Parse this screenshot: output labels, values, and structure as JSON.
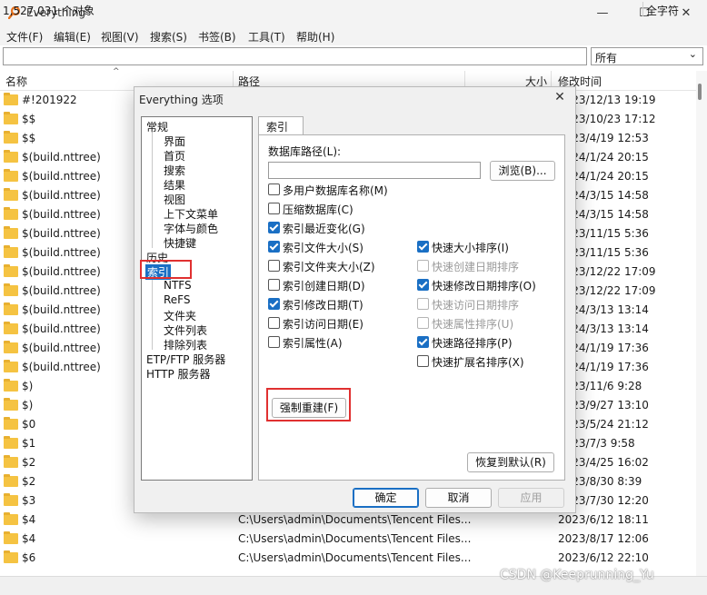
{
  "window": {
    "title": "Everything",
    "minimize": "—",
    "maximize": "☐",
    "close": "✕"
  },
  "menu": [
    "文件(F)",
    "编辑(E)",
    "视图(V)",
    "搜索(S)",
    "书签(B)",
    "工具(T)",
    "帮助(H)"
  ],
  "search": {
    "value": "",
    "filter": "所有"
  },
  "columns": {
    "name": "名称",
    "path": "路径",
    "size": "大小",
    "modified": "修改时间"
  },
  "rows": [
    {
      "name": "#!201922",
      "path": "",
      "date": "2023/12/13 19:19"
    },
    {
      "name": "$$",
      "path": "",
      "date": "2023/10/23 17:12"
    },
    {
      "name": "$$",
      "path": "",
      "date": "2023/4/19 12:53"
    },
    {
      "name": "$(build.nttree)",
      "path": "",
      "date": "2024/1/24 20:15"
    },
    {
      "name": "$(build.nttree)",
      "path": "",
      "date": "2024/1/24 20:15"
    },
    {
      "name": "$(build.nttree)",
      "path": "",
      "date": "2024/3/15 14:58"
    },
    {
      "name": "$(build.nttree)",
      "path": "",
      "date": "2024/3/15 14:58"
    },
    {
      "name": "$(build.nttree)",
      "path": "",
      "date": "2023/11/15 5:36"
    },
    {
      "name": "$(build.nttree)",
      "path": "",
      "date": "2023/11/15 5:36"
    },
    {
      "name": "$(build.nttree)",
      "path": "",
      "date": "2023/12/22 17:09"
    },
    {
      "name": "$(build.nttree)",
      "path": "",
      "date": "2023/12/22 17:09"
    },
    {
      "name": "$(build.nttree)",
      "path": "",
      "date": "2024/3/13 13:14"
    },
    {
      "name": "$(build.nttree)",
      "path": "",
      "date": "2024/3/13 13:14"
    },
    {
      "name": "$(build.nttree)",
      "path": "",
      "date": "2024/1/19 17:36"
    },
    {
      "name": "$(build.nttree)",
      "path": "",
      "date": "2024/1/19 17:36"
    },
    {
      "name": "$)",
      "path": "",
      "date": "2023/11/6 9:28"
    },
    {
      "name": "$)",
      "path": "",
      "date": "2023/9/27 13:10"
    },
    {
      "name": "$0",
      "path": "",
      "date": "2023/5/24 21:12"
    },
    {
      "name": "$1",
      "path": "",
      "date": "2023/7/3 9:58"
    },
    {
      "name": "$2",
      "path": "",
      "date": "2023/4/25 16:02"
    },
    {
      "name": "$2",
      "path": "",
      "date": "2023/8/30 8:39"
    },
    {
      "name": "$3",
      "path": "",
      "date": "2023/7/30 12:20"
    },
    {
      "name": "$4",
      "path": "C:\\Users\\admin\\Documents\\Tencent Files...",
      "date": "2023/6/12 18:11"
    },
    {
      "name": "$4",
      "path": "C:\\Users\\admin\\Documents\\Tencent Files...",
      "date": "2023/8/17 12:06"
    },
    {
      "name": "$6",
      "path": "C:\\Users\\admin\\Documents\\Tencent Files...",
      "date": "2023/6/12 22:10"
    }
  ],
  "status": {
    "count": "1,527,031 个对象",
    "right": "全字符"
  },
  "dialog": {
    "title": "Everything 选项",
    "close": "✕",
    "tree": {
      "general": "常规",
      "general_children": [
        "界面",
        "首页",
        "搜索",
        "结果",
        "视图",
        "上下文菜单",
        "字体与颜色",
        "快捷键"
      ],
      "history": "历史",
      "index": "索引",
      "index_children": [
        "NTFS",
        "ReFS",
        "文件夹",
        "文件列表",
        "排除列表"
      ],
      "ftp": "ETP/FTP 服务器",
      "http": "HTTP 服务器"
    },
    "tab": "索引",
    "db_path_label": "数据库路径(L):",
    "db_path_value": "",
    "browse": "浏览(B)...",
    "options_left": [
      {
        "label": "多用户数据库名称(M)",
        "checked": false
      },
      {
        "label": "压缩数据库(C)",
        "checked": false
      },
      {
        "label": "索引最近变化(G)",
        "checked": true
      },
      {
        "label": "索引文件大小(S)",
        "checked": true
      },
      {
        "label": "索引文件夹大小(Z)",
        "checked": false
      },
      {
        "label": "索引创建日期(D)",
        "checked": false
      },
      {
        "label": "索引修改日期(T)",
        "checked": true
      },
      {
        "label": "索引访问日期(E)",
        "checked": false
      },
      {
        "label": "索引属性(A)",
        "checked": false
      }
    ],
    "options_right": [
      {
        "label": "快速大小排序(I)",
        "checked": true,
        "disabled": false
      },
      {
        "label": "快速创建日期排序",
        "checked": false,
        "disabled": true
      },
      {
        "label": "快速修改日期排序(O)",
        "checked": true,
        "disabled": false
      },
      {
        "label": "快速访问日期排序",
        "checked": false,
        "disabled": true
      },
      {
        "label": "快速属性排序(U)",
        "checked": false,
        "disabled": true
      },
      {
        "label": "快速路径排序(P)",
        "checked": true,
        "disabled": false
      },
      {
        "label": "快速扩展名排序(X)",
        "checked": false,
        "disabled": false
      }
    ],
    "force_rebuild": "强制重建(F)",
    "restore_defaults": "恢复到默认(R)",
    "ok": "确定",
    "cancel": "取消",
    "apply": "应用"
  },
  "watermark": "CSDN @Keeprunning_Yu",
  "colors": {
    "accent": "#1a6fc4",
    "highlight_box": "#e03030",
    "folder": "#f5c342"
  }
}
